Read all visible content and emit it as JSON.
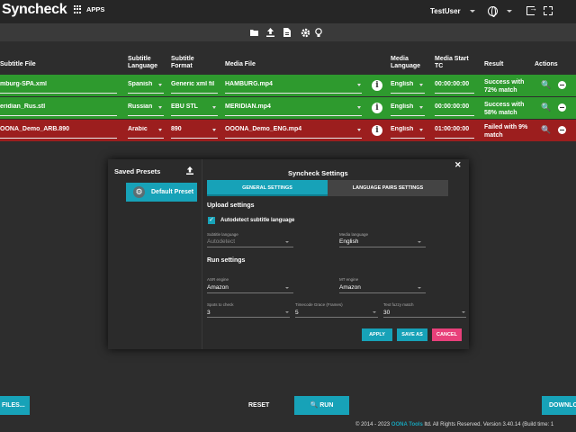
{
  "header": {
    "app_title": "Syncheck",
    "apps_label": "APPS",
    "user_name": "TestUser"
  },
  "table": {
    "headers": {
      "subtitle_file": "Subtitle File",
      "subtitle_language": "Subtitle Language",
      "subtitle_format": "Subtitle Format",
      "media_file": "Media File",
      "media_language": "Media Language",
      "media_start_tc": "Media Start TC",
      "result": "Result",
      "actions": "Actions"
    },
    "rows": [
      {
        "subtitle_file": "mburg-SPA.xml",
        "subtitle_language": "Spanish",
        "subtitle_format": "Generic xml filu",
        "media_file": "HAMBURG.mp4",
        "media_language": "English",
        "media_start_tc": "00:00:00:00",
        "result_line1": "Success with",
        "result_line2": "72% match",
        "status": "success"
      },
      {
        "subtitle_file": "eridian_Rus.stl",
        "subtitle_language": "Russian",
        "subtitle_format": "EBU STL",
        "media_file": "MERIDIAN.mp4",
        "media_language": "English",
        "media_start_tc": "00:00:00:00",
        "result_line1": "Success with",
        "result_line2": "58% match",
        "status": "success"
      },
      {
        "subtitle_file": "OONA_Demo_ARB.890",
        "subtitle_language": "Arabic",
        "subtitle_format": "890",
        "media_file": "OOONA_Demo_ENG.mp4",
        "media_language": "English",
        "media_start_tc": "01:00:00:00",
        "result_line1": "Failed with 9%",
        "result_line2": "match",
        "status": "failed"
      }
    ]
  },
  "dialog": {
    "saved_presets_title": "Saved Presets",
    "preset_default": "Default Preset",
    "title": "Syncheck Settings",
    "tab_general": "GENERAL SETTINGS",
    "tab_language_pairs": "LANGUAGE PAIRS SETTINGS",
    "upload_settings_title": "Upload settings",
    "autodetect_label": "Autodetect subtitle language",
    "subtitle_language_label": "Subtitle language",
    "subtitle_language_value": "Autodetect",
    "media_language_label": "Media language",
    "media_language_value": "English",
    "run_settings_title": "Run settings",
    "asr_engine_label": "ASR engine",
    "asr_engine_value": "Amazon",
    "mt_engine_label": "MT engine",
    "mt_engine_value": "Amazon",
    "spots_label": "Spots to check",
    "spots_value": "3",
    "timecode_label": "Timecode Grace (Frames)",
    "timecode_value": "5",
    "fuzzy_label": "Text fuzzy match",
    "fuzzy_value": "30",
    "apply_label": "APPLY",
    "save_as_label": "SAVE AS",
    "cancel_label": "CANCEL"
  },
  "bottom": {
    "files_label": "FILES...",
    "reset_label": "RESET",
    "run_label": "RUN",
    "download_label": "DOWNLO"
  },
  "footer": {
    "prefix": "© 2014 - 2023 ",
    "brand": "OONA Tools",
    "suffix": " ltd. All Rights Reserved. Version 3.40.14 (Build time: 1"
  },
  "colors": {
    "success_row": "#2e9a2e",
    "failed_row": "#9c1e1e",
    "accent": "#17a2b8",
    "cancel": "#e8407a"
  }
}
